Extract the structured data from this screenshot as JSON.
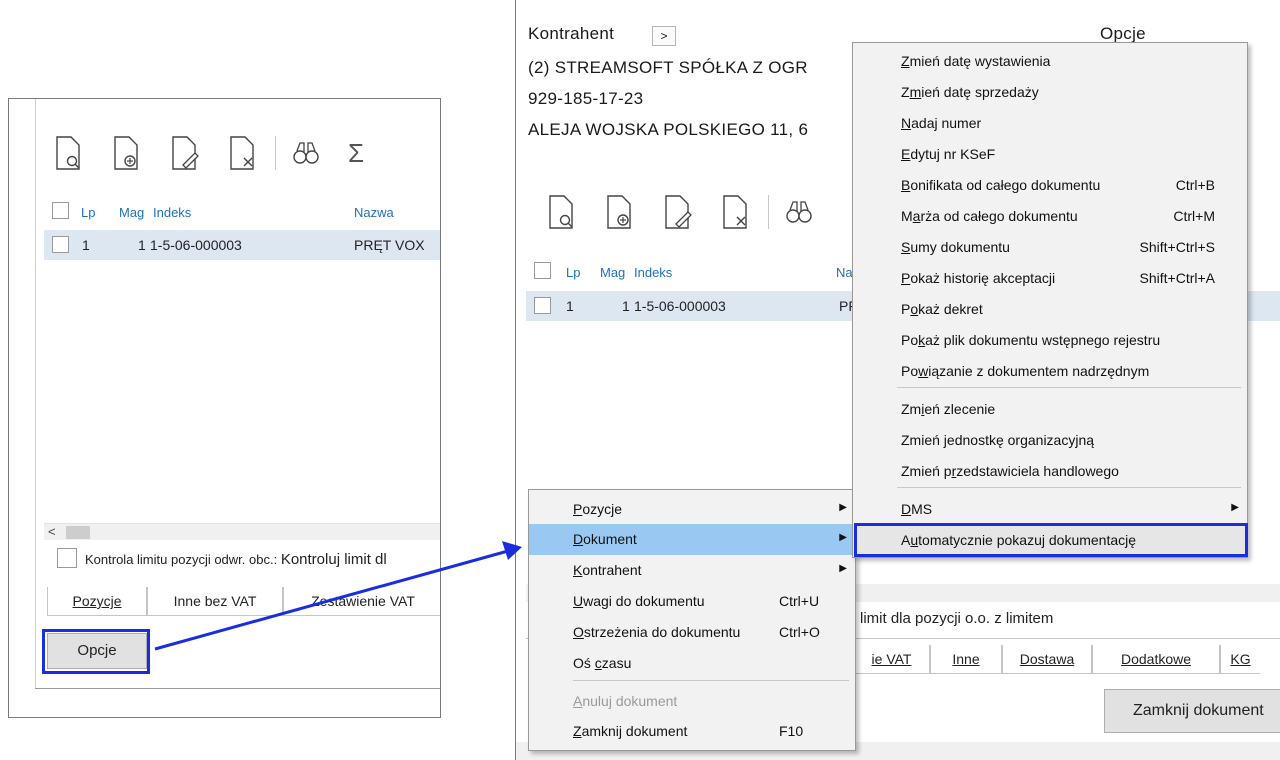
{
  "left_window": {
    "grid": {
      "headers": {
        "lp": "Lp",
        "mag": "Mag",
        "indeks": "Indeks",
        "nazwa": "Nazwa"
      },
      "row": {
        "lp": "1",
        "mag": "1",
        "indeks": "1-5-06-000003",
        "nazwa": "PRĘT VOX"
      }
    },
    "scroll_left": "<",
    "limit_label": "Kontrola limitu pozycji odwr. obc.:",
    "limit_value": "Kontroluj limit dl",
    "tabs": [
      "Pozycje",
      "Inne bez VAT",
      "Zestawienie VAT"
    ],
    "options_button": "Opcje"
  },
  "right_window": {
    "kontrahent_label": "Kontrahent",
    "nav_arrow": ">",
    "opcje_label": "Opcje",
    "company_name": "(2) STREAMSOFT SPÓŁKA Z OGR",
    "nip": "929-185-17-23",
    "address": "ALEJA WOJSKA POLSKIEGO 11, 6",
    "grid": {
      "headers": {
        "lp": "Lp",
        "mag": "Mag",
        "indeks": "Indeks",
        "nazwa": "Na"
      },
      "row": {
        "lp": "1",
        "mag": "1",
        "indeks": "1-5-06-000003",
        "nazwa": "PF"
      }
    },
    "limit_value": "limit dla pozycji o.o. z limitem",
    "tabs": [
      "ie VAT",
      "Inne",
      "Dostawa",
      "Dodatkowe",
      "KG"
    ],
    "close_button": "Zamknij dokument"
  },
  "context_menu": {
    "items": [
      {
        "pre": "",
        "u": "P",
        "post": "ozycje",
        "shortcut": "",
        "submenu": true,
        "selected": false,
        "disabled": false
      },
      {
        "pre": "",
        "u": "D",
        "post": "okument",
        "shortcut": "",
        "submenu": true,
        "selected": true,
        "disabled": false
      },
      {
        "pre": "",
        "u": "K",
        "post": "ontrahent",
        "shortcut": "",
        "submenu": true,
        "selected": false,
        "disabled": false
      },
      {
        "pre": "",
        "u": "U",
        "post": "wagi do dokumentu",
        "shortcut": "Ctrl+U",
        "submenu": false,
        "selected": false,
        "disabled": false
      },
      {
        "pre": "",
        "u": "O",
        "post": "strzeżenia do dokumentu",
        "shortcut": "Ctrl+O",
        "submenu": false,
        "selected": false,
        "disabled": false
      },
      {
        "pre": "Oś ",
        "u": "c",
        "post": "zasu",
        "shortcut": "",
        "submenu": false,
        "selected": false,
        "disabled": false
      },
      {
        "pre": "",
        "u": "A",
        "post": "nuluj dokument",
        "shortcut": "",
        "submenu": false,
        "selected": false,
        "disabled": true
      },
      {
        "pre": "",
        "u": "Z",
        "post": "amknij dokument",
        "shortcut": "F10",
        "submenu": false,
        "selected": false,
        "disabled": false
      }
    ]
  },
  "submenu": {
    "items": [
      {
        "pre": "",
        "u": "Z",
        "post": "mień datę wystawienia",
        "shortcut": ""
      },
      {
        "pre": "Z",
        "u": "m",
        "post": "ień datę sprzedaży",
        "shortcut": ""
      },
      {
        "pre": "",
        "u": "N",
        "post": "adaj numer",
        "shortcut": ""
      },
      {
        "pre": "",
        "u": "E",
        "post": "dytuj nr KSeF",
        "shortcut": ""
      },
      {
        "pre": "",
        "u": "B",
        "post": "onifikata od całego dokumentu",
        "shortcut": "Ctrl+B"
      },
      {
        "pre": "M",
        "u": "a",
        "post": "rża od całego dokumentu",
        "shortcut": "Ctrl+M"
      },
      {
        "pre": "",
        "u": "S",
        "post": "umy dokumentu",
        "shortcut": "Shift+Ctrl+S"
      },
      {
        "pre": "",
        "u": "P",
        "post": "okaż historię akceptacji",
        "shortcut": "Shift+Ctrl+A"
      },
      {
        "pre": "P",
        "u": "o",
        "post": "każ dekret",
        "shortcut": ""
      },
      {
        "pre": "Po",
        "u": "k",
        "post": "aż plik dokumentu wstępnego rejestru",
        "shortcut": ""
      },
      {
        "pre": "Po",
        "u": "w",
        "post": "iązanie z dokumentem nadrzędnym",
        "shortcut": ""
      },
      {
        "pre": "Zm",
        "u": "i",
        "post": "eń zlecenie",
        "shortcut": ""
      },
      {
        "pre": "Zmień ",
        "u": "j",
        "post": "ednostkę organizacyjną",
        "shortcut": ""
      },
      {
        "pre": "Zmień p",
        "u": "r",
        "post": "zedstawiciela handlowego",
        "shortcut": ""
      },
      {
        "pre": "",
        "u": "D",
        "post": "MS",
        "shortcut": ""
      },
      {
        "pre": "A",
        "u": "u",
        "post": "tomatycznie pokazuj dokumentację",
        "shortcut": ""
      }
    ]
  },
  "colors": {
    "highlight": "#1a2ee0",
    "menu_selected": "#99c9f2",
    "link": "#2f7fd1"
  }
}
